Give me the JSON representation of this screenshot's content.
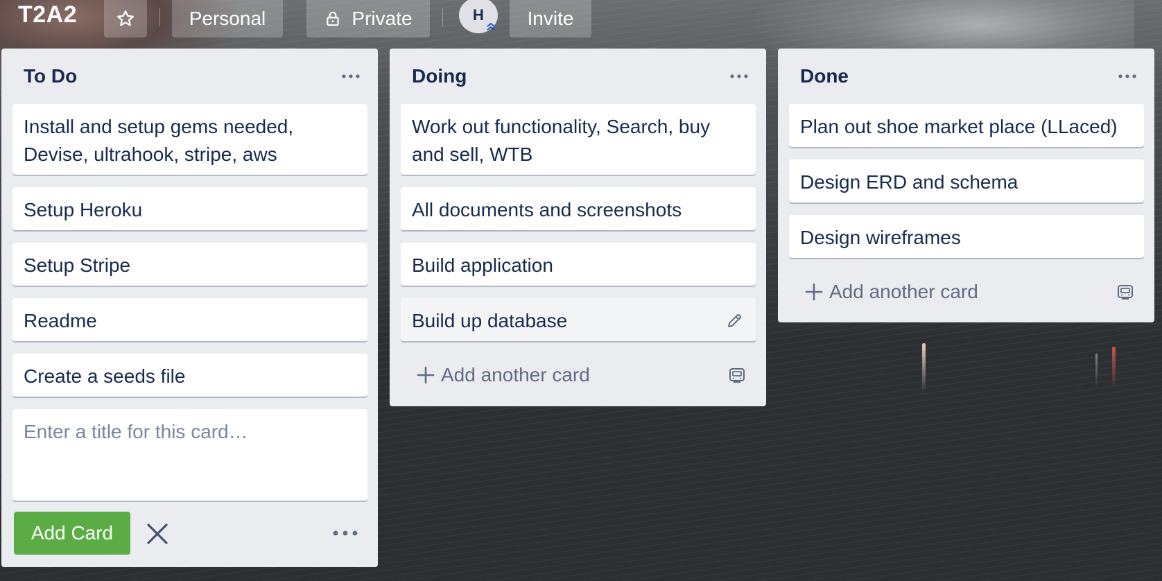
{
  "board": {
    "title": "T2A2",
    "visibility_team": "Personal",
    "visibility": "Private",
    "member_initial": "H",
    "invite_label": "Invite"
  },
  "lists": [
    {
      "title": "To Do",
      "cards": [
        "Install and setup gems needed, Devise, ultrahook, stripe, aws",
        "Setup Heroku",
        "Setup Stripe",
        "Readme",
        "Create a seeds file"
      ],
      "composer": {
        "placeholder": "Enter a title for this card…",
        "add_label": "Add Card"
      }
    },
    {
      "title": "Doing",
      "cards": [
        "Work out functionality, Search, buy and sell, WTB",
        "All documents and screenshots",
        "Build application",
        "Build up database"
      ],
      "add_another_label": "Add another card"
    },
    {
      "title": "Done",
      "cards": [
        "Plan out shoe market place (LLaced)",
        "Design ERD and schema",
        "Design wireframes"
      ],
      "add_another_label": "Add another card"
    }
  ],
  "icons": {
    "star": "star-icon",
    "lock": "lock-icon",
    "list_menu": "more-icon",
    "edit": "pencil-icon",
    "plus": "plus-icon",
    "template": "card-template-icon",
    "close": "close-icon"
  },
  "colors": {
    "list_bg": "#ebecf0",
    "card_bg": "#ffffff",
    "text": "#172b4d",
    "muted": "#5e6c84",
    "add_button": "#5aac44"
  }
}
